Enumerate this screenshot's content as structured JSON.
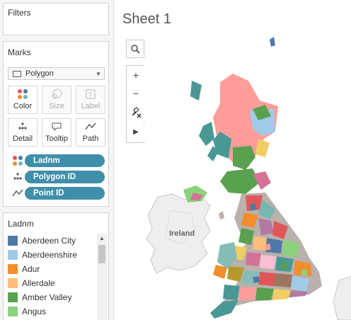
{
  "filters": {
    "title": "Filters"
  },
  "marks": {
    "title": "Marks",
    "type": "Polygon",
    "buttons": [
      {
        "label": "Color",
        "icon": "color-dots-icon",
        "enabled": true
      },
      {
        "label": "Size",
        "icon": "size-icon",
        "enabled": false
      },
      {
        "label": "Label",
        "icon": "label-icon",
        "enabled": false
      },
      {
        "label": "Detail",
        "icon": "detail-icon",
        "enabled": true
      },
      {
        "label": "Tooltip",
        "icon": "tooltip-icon",
        "enabled": true
      },
      {
        "label": "Path",
        "icon": "path-icon",
        "enabled": true
      }
    ],
    "pills": [
      {
        "label": "Ladnm",
        "icon": "color-dots-icon"
      },
      {
        "label": "Polygon ID",
        "icon": "detail-icon"
      },
      {
        "label": "Point ID",
        "icon": "path-icon"
      }
    ]
  },
  "legend": {
    "title": "Ladnm",
    "items": [
      {
        "label": "Aberdeen City",
        "color": "#4e79a7"
      },
      {
        "label": "Aberdeenshire",
        "color": "#a0cbe8"
      },
      {
        "label": "Adur",
        "color": "#f28e2b"
      },
      {
        "label": "Allerdale",
        "color": "#ffbe7d"
      },
      {
        "label": "Amber Valley",
        "color": "#59a14f"
      },
      {
        "label": "Angus",
        "color": "#8cd17d"
      }
    ]
  },
  "sheet": {
    "title": "Sheet 1",
    "map_label": "Ireland"
  },
  "map_tools": [
    "search-icon",
    "zoom-in-icon",
    "zoom-out-icon",
    "unpin-icon",
    "expand-arrow-icon"
  ]
}
